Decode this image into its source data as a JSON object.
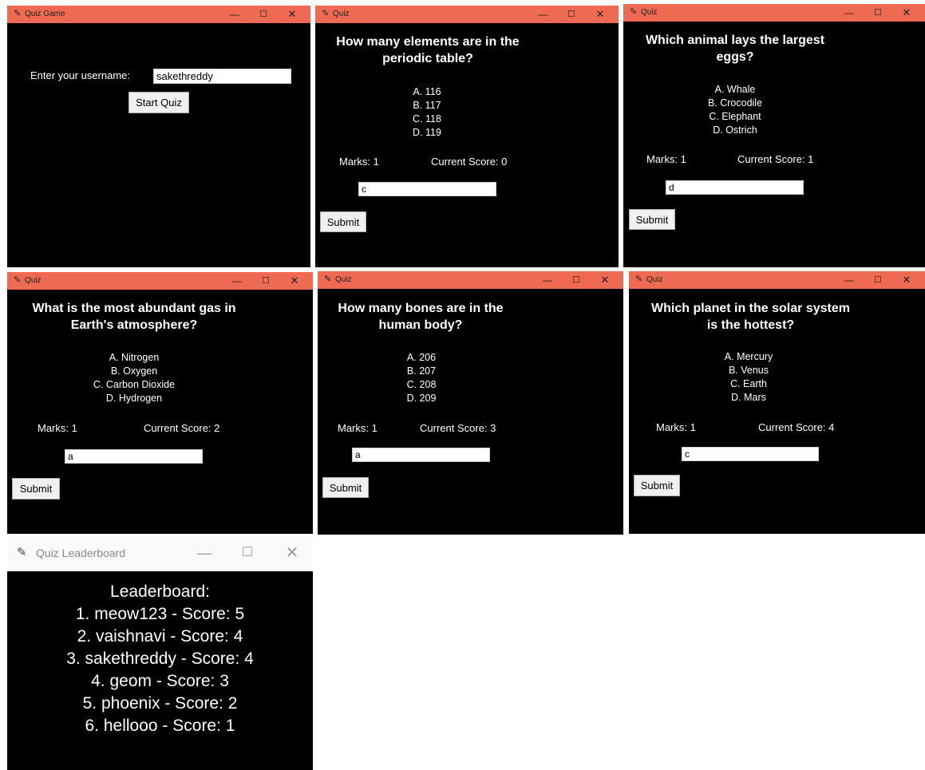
{
  "login_window": {
    "title": "Quiz Game",
    "label": "Enter your username:",
    "username": "sakethreddy",
    "start_button": "Start Quiz"
  },
  "quiz_windows": [
    {
      "title": "Quiz",
      "question": "How many elements are in the periodic table?",
      "question_lines": [
        "How many elements are in the",
        "periodic table?"
      ],
      "options": [
        "A. 116",
        "B. 117",
        "C. 118",
        "D. 119"
      ],
      "marks": "Marks: 1",
      "score": "Current Score: 0",
      "answer": "c",
      "submit": "Submit"
    },
    {
      "title": "Quiz",
      "question": "Which animal lays the largest eggs?",
      "question_lines": [
        "Which animal lays the largest",
        "eggs?"
      ],
      "options": [
        "A. Whale",
        "B. Crocodile",
        "C. Elephant",
        "D. Ostrich"
      ],
      "marks": "Marks: 1",
      "score": "Current Score: 1",
      "answer": "d",
      "submit": "Submit"
    },
    {
      "title": "Quiz",
      "question": "What is the most abundant gas in Earth's atmosphere?",
      "question_lines": [
        "What is the most abundant gas in",
        "Earth's atmosphere?"
      ],
      "options": [
        "A. Nitrogen",
        "B. Oxygen",
        "C. Carbon Dioxide",
        "D. Hydrogen"
      ],
      "marks": "Marks: 1",
      "score": "Current Score: 2",
      "answer": "a",
      "submit": "Submit"
    },
    {
      "title": "Quiz",
      "question": "How many bones are in the human body?",
      "question_lines": [
        "How many bones are in the",
        "human body?"
      ],
      "options": [
        "A. 206",
        "B. 207",
        "C. 208",
        "D. 209"
      ],
      "marks": "Marks: 1",
      "score": "Current Score: 3",
      "answer": "a",
      "submit": "Submit"
    },
    {
      "title": "Quiz",
      "question": "Which planet in the solar system is the hottest?",
      "question_lines": [
        "Which planet in the solar system",
        "is the hottest?"
      ],
      "options": [
        "A. Mercury",
        "B. Venus",
        "C. Earth",
        "D. Mars"
      ],
      "marks": "Marks: 1",
      "score": "Current Score: 4",
      "answer": "c",
      "submit": "Submit"
    }
  ],
  "leaderboard_window": {
    "title": "Quiz Leaderboard",
    "heading": "Leaderboard:",
    "entries": [
      "1. meow123 - Score: 5",
      "2. vaishnavi - Score: 4",
      "3. sakethreddy - Score: 4",
      "4. geom - Score: 3",
      "5. phoenix - Score: 2",
      "6. hellooo - Score: 1"
    ]
  },
  "colors": {
    "titlebar": "#ef6a52",
    "client_bg": "#000000",
    "text": "#ffffff"
  },
  "icons": {
    "app": "feather-icon",
    "minimize": "minimize-icon",
    "maximize": "maximize-icon",
    "close": "close-icon"
  }
}
